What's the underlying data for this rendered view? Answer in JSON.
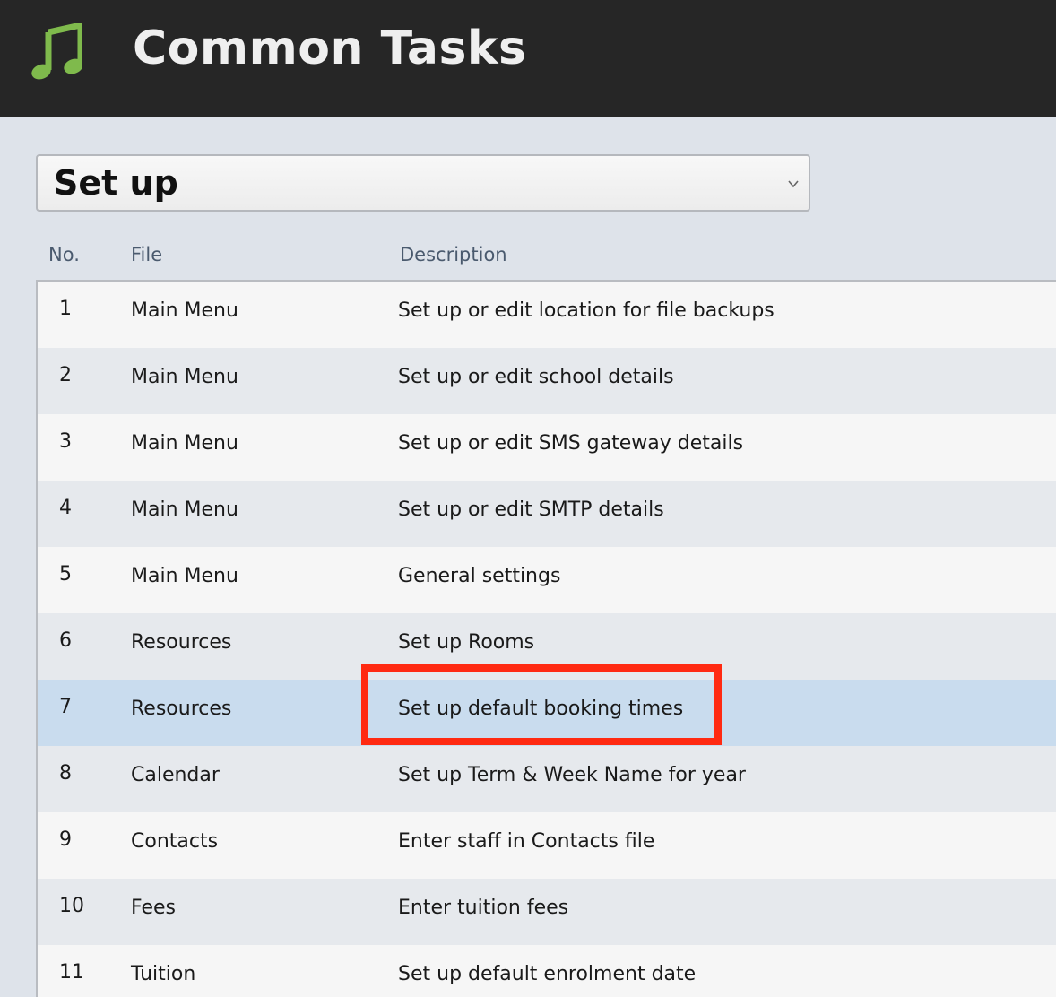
{
  "header": {
    "title": "Common Tasks",
    "logo_icon": "music-note-icon",
    "logo_color": "#7fba4c"
  },
  "category_select": {
    "selected": "Set up",
    "icon": "chevron-down-icon"
  },
  "table": {
    "columns": [
      "No.",
      "File",
      "Description"
    ],
    "selected_row": 7,
    "rows": [
      {
        "no": "1",
        "file": "Main Menu",
        "description": "Set up or edit location for file backups"
      },
      {
        "no": "2",
        "file": "Main Menu",
        "description": "Set up or edit school details"
      },
      {
        "no": "3",
        "file": "Main Menu",
        "description": "Set up or edit SMS gateway details"
      },
      {
        "no": "4",
        "file": "Main Menu",
        "description": "Set up or edit SMTP details"
      },
      {
        "no": "5",
        "file": "Main Menu",
        "description": "General settings"
      },
      {
        "no": "6",
        "file": "Resources",
        "description": "Set up Rooms"
      },
      {
        "no": "7",
        "file": "Resources",
        "description": "Set up default booking times"
      },
      {
        "no": "8",
        "file": "Calendar",
        "description": "Set up Term & Week Name for year"
      },
      {
        "no": "9",
        "file": "Contacts",
        "description": "Enter staff in Contacts file"
      },
      {
        "no": "10",
        "file": "Fees",
        "description": "Enter tuition fees"
      },
      {
        "no": "11",
        "file": "Tuition",
        "description": "Set up default enrolment date"
      }
    ]
  },
  "annotation": {
    "highlight_color": "#ff2a12"
  }
}
